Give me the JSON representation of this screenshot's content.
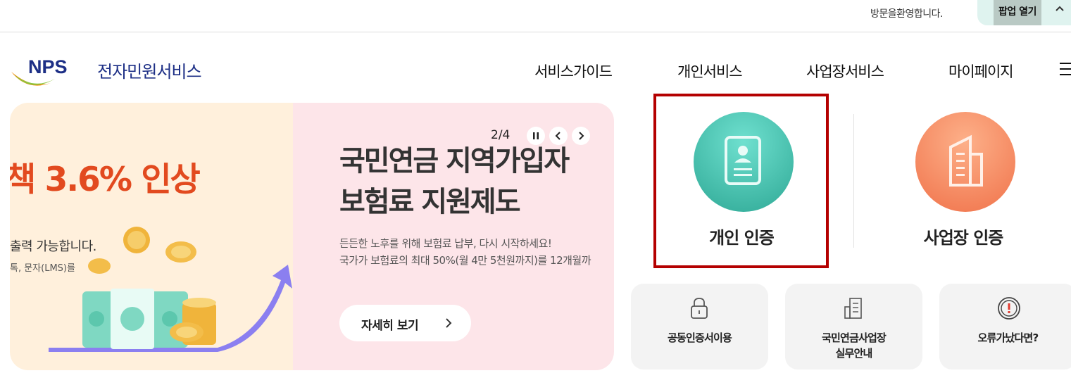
{
  "topbar": {
    "welcome": "방문을환영합니다.",
    "popup_label": "팝업 열기"
  },
  "header": {
    "logo_brand": "NPS",
    "logo_text": "전자민원서비스",
    "nav": [
      "서비스가이드",
      "개인서비스",
      "사업장서비스",
      "마이페이지"
    ]
  },
  "banner": {
    "rate_text": "책 3.6% 인상",
    "side_line1": "출력 가능합니다.",
    "side_line2": "톡, 문자(LMS)를",
    "title_line1": "국민연금 지역가입자",
    "title_line2": "보험료 지원제도",
    "desc_line1": "든든한 노후를 위해 보험료 납부, 다시 시작하세요!",
    "desc_line2": "국가가 보험료의 최대 50%(월 4만 5천원까지)를 12개월까",
    "more_button": "자세히 보기",
    "pager": "2/4"
  },
  "auth": {
    "personal": "개인 인증",
    "business": "사업장 인증"
  },
  "cards": [
    {
      "label": "공동인증서이용",
      "icon": "lock-icon"
    },
    {
      "label_line1": "국민연금사업장",
      "label_line2": "실무안내",
      "icon": "document-icon"
    },
    {
      "label": "오류가났다면?",
      "icon": "alert-icon"
    }
  ],
  "colors": {
    "brand_blue": "#1d2f86",
    "personal_teal": "#3cbfae",
    "business_orange": "#f6835d",
    "highlight_red": "#b40000",
    "rate_orange": "#e24a1f"
  }
}
